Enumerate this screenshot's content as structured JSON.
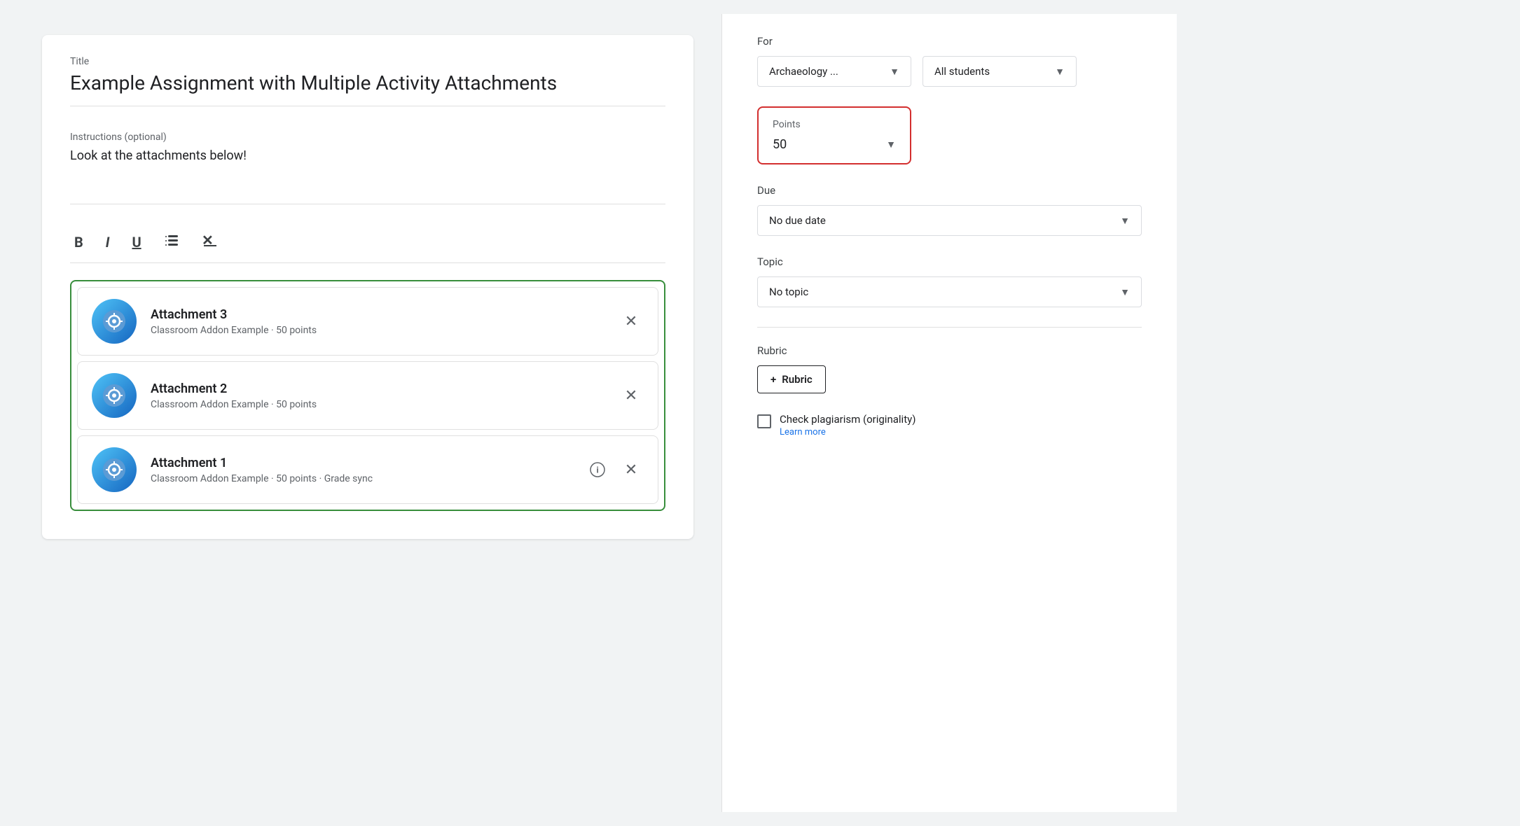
{
  "left": {
    "title_label": "Title",
    "title_value": "Example Assignment with Multiple Activity Attachments",
    "instructions_label": "Instructions (optional)",
    "instructions_text": "Look at the attachments below!",
    "toolbar": {
      "bold": "B",
      "italic": "I",
      "underline": "U",
      "list": "≡",
      "clear": "✕"
    },
    "attachments": [
      {
        "name": "Attachment 3",
        "meta": "Classroom Addon Example · 50 points",
        "has_info": false
      },
      {
        "name": "Attachment 2",
        "meta": "Classroom Addon Example · 50 points",
        "has_info": false
      },
      {
        "name": "Attachment 1",
        "meta": "Classroom Addon Example · 50 points · Grade sync",
        "has_info": true
      }
    ]
  },
  "right": {
    "for_label": "For",
    "class_dropdown": "Archaeology ...",
    "students_dropdown": "All students",
    "points_label": "Points",
    "points_value": "50",
    "due_label": "Due",
    "due_dropdown": "No due date",
    "topic_label": "Topic",
    "topic_dropdown": "No topic",
    "rubric_label": "Rubric",
    "rubric_button": "Rubric",
    "rubric_plus": "+",
    "plagiarism_label": "Check plagiarism (originality)",
    "plagiarism_subtext": "Learn more"
  }
}
